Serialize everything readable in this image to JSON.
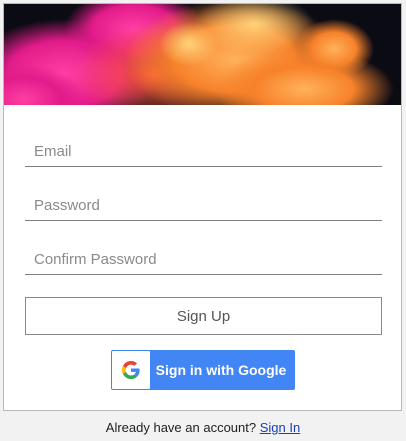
{
  "form": {
    "email_placeholder": "Email",
    "password_placeholder": "Password",
    "confirm_placeholder": "Confirm Password",
    "signup_label": "Sign Up"
  },
  "google": {
    "label": "Sign in with Google",
    "icon": "google-g-icon"
  },
  "footer": {
    "prompt": "Already have an account?",
    "signin_link": "Sign In"
  },
  "colors": {
    "google_blue": "#4285f4",
    "link_blue": "#1a3fb5"
  }
}
